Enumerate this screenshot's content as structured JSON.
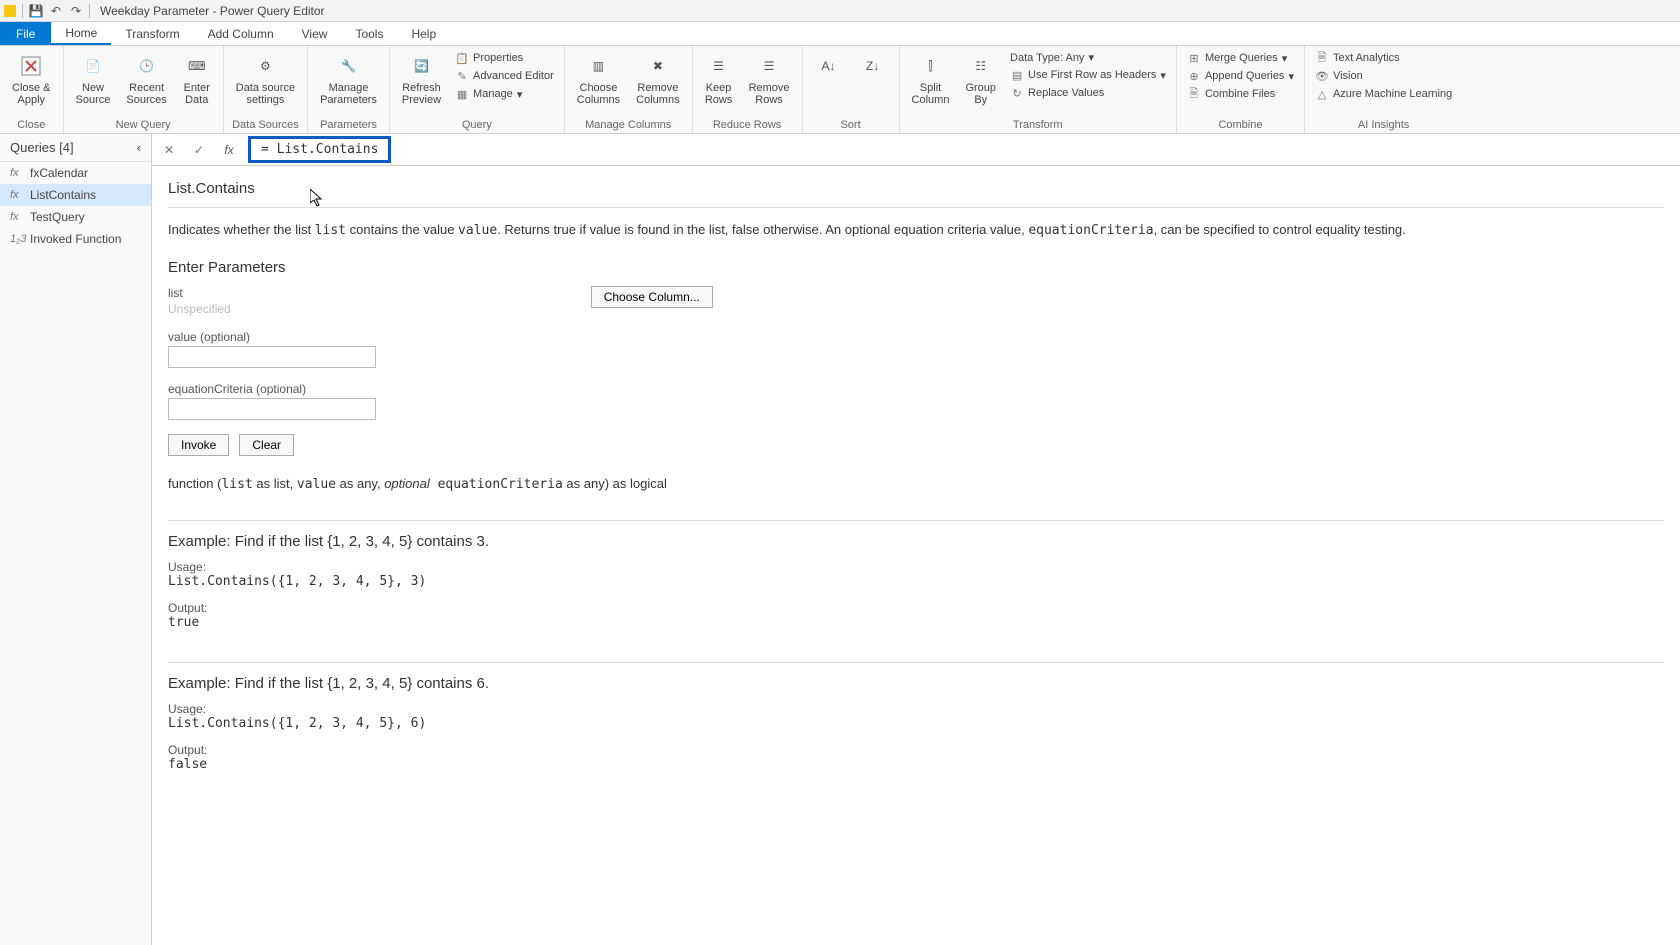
{
  "title": "Weekday Parameter - Power Query Editor",
  "menu": {
    "file": "File",
    "home": "Home",
    "transform": "Transform",
    "addcolumn": "Add Column",
    "view": "View",
    "tools": "Tools",
    "help": "Help"
  },
  "ribbon": {
    "close": {
      "closeapply": "Close &\nApply",
      "group": "Close"
    },
    "newquery": {
      "newsource": "New\nSource",
      "recent": "Recent\nSources",
      "enterdata": "Enter\nData",
      "group": "New Query"
    },
    "datasources": {
      "settings": "Data source\nsettings",
      "group": "Data Sources"
    },
    "parameters": {
      "manage": "Manage\nParameters",
      "group": "Parameters"
    },
    "query": {
      "refresh": "Refresh\nPreview",
      "properties": "Properties",
      "advanced": "Advanced Editor",
      "manage": "Manage",
      "group": "Query"
    },
    "managecols": {
      "choose": "Choose\nColumns",
      "remove": "Remove\nColumns",
      "group": "Manage Columns"
    },
    "reducerows": {
      "keep": "Keep\nRows",
      "remove": "Remove\nRows",
      "group": "Reduce Rows"
    },
    "sort": {
      "group": "Sort"
    },
    "transform": {
      "split": "Split\nColumn",
      "groupby": "Group\nBy",
      "datatype": "Data Type: Any",
      "firstrow": "Use First Row as Headers",
      "replace": "Replace Values",
      "group": "Transform"
    },
    "combine": {
      "merge": "Merge Queries",
      "append": "Append Queries",
      "combinefiles": "Combine Files",
      "group": "Combine"
    },
    "ai": {
      "textanalytics": "Text Analytics",
      "vision": "Vision",
      "aml": "Azure Machine Learning",
      "group": "AI Insights"
    }
  },
  "queries": {
    "header": "Queries [4]",
    "items": [
      "fxCalendar",
      "ListContains",
      "TestQuery",
      "Invoked Function"
    ],
    "icons": [
      "fx",
      "fx",
      "fx",
      "1₂3"
    ]
  },
  "formula": "= List.Contains",
  "fn": {
    "name": "List.Contains",
    "desc_pre": "Indicates whether the list ",
    "desc_list": "list",
    "desc_mid1": " contains the value ",
    "desc_value": "value",
    "desc_mid2": ". Returns true if value is found in the list, false otherwise. An optional equation criteria value, ",
    "desc_eq": "equationCriteria",
    "desc_post": ", can be specified to control equality testing.",
    "enter_params": "Enter Parameters",
    "p1_label": "list",
    "p1_placeholder": "Unspecified",
    "choose_column": "Choose Column...",
    "p2_label": "value (optional)",
    "p3_label": "equationCriteria (optional)",
    "invoke": "Invoke",
    "clear": "Clear",
    "sig_pre": "function (",
    "sig_list": "list",
    "sig_aslist": " as list, ",
    "sig_value": "value",
    "sig_asany": " as any, ",
    "sig_opt": "optional",
    "sig_eq": " equationCriteria",
    "sig_post": " as any) as logical",
    "ex1_h": "Example: Find if the list {1, 2, 3, 4, 5} contains 3.",
    "usage": "Usage:",
    "ex1_code": "List.Contains({1, 2, 3, 4, 5}, 3)",
    "output": "Output:",
    "ex1_out": "true",
    "ex2_h": "Example: Find if the list {1, 2, 3, 4, 5} contains 6.",
    "ex2_code": "List.Contains({1, 2, 3, 4, 5}, 6)",
    "ex2_out": "false"
  }
}
